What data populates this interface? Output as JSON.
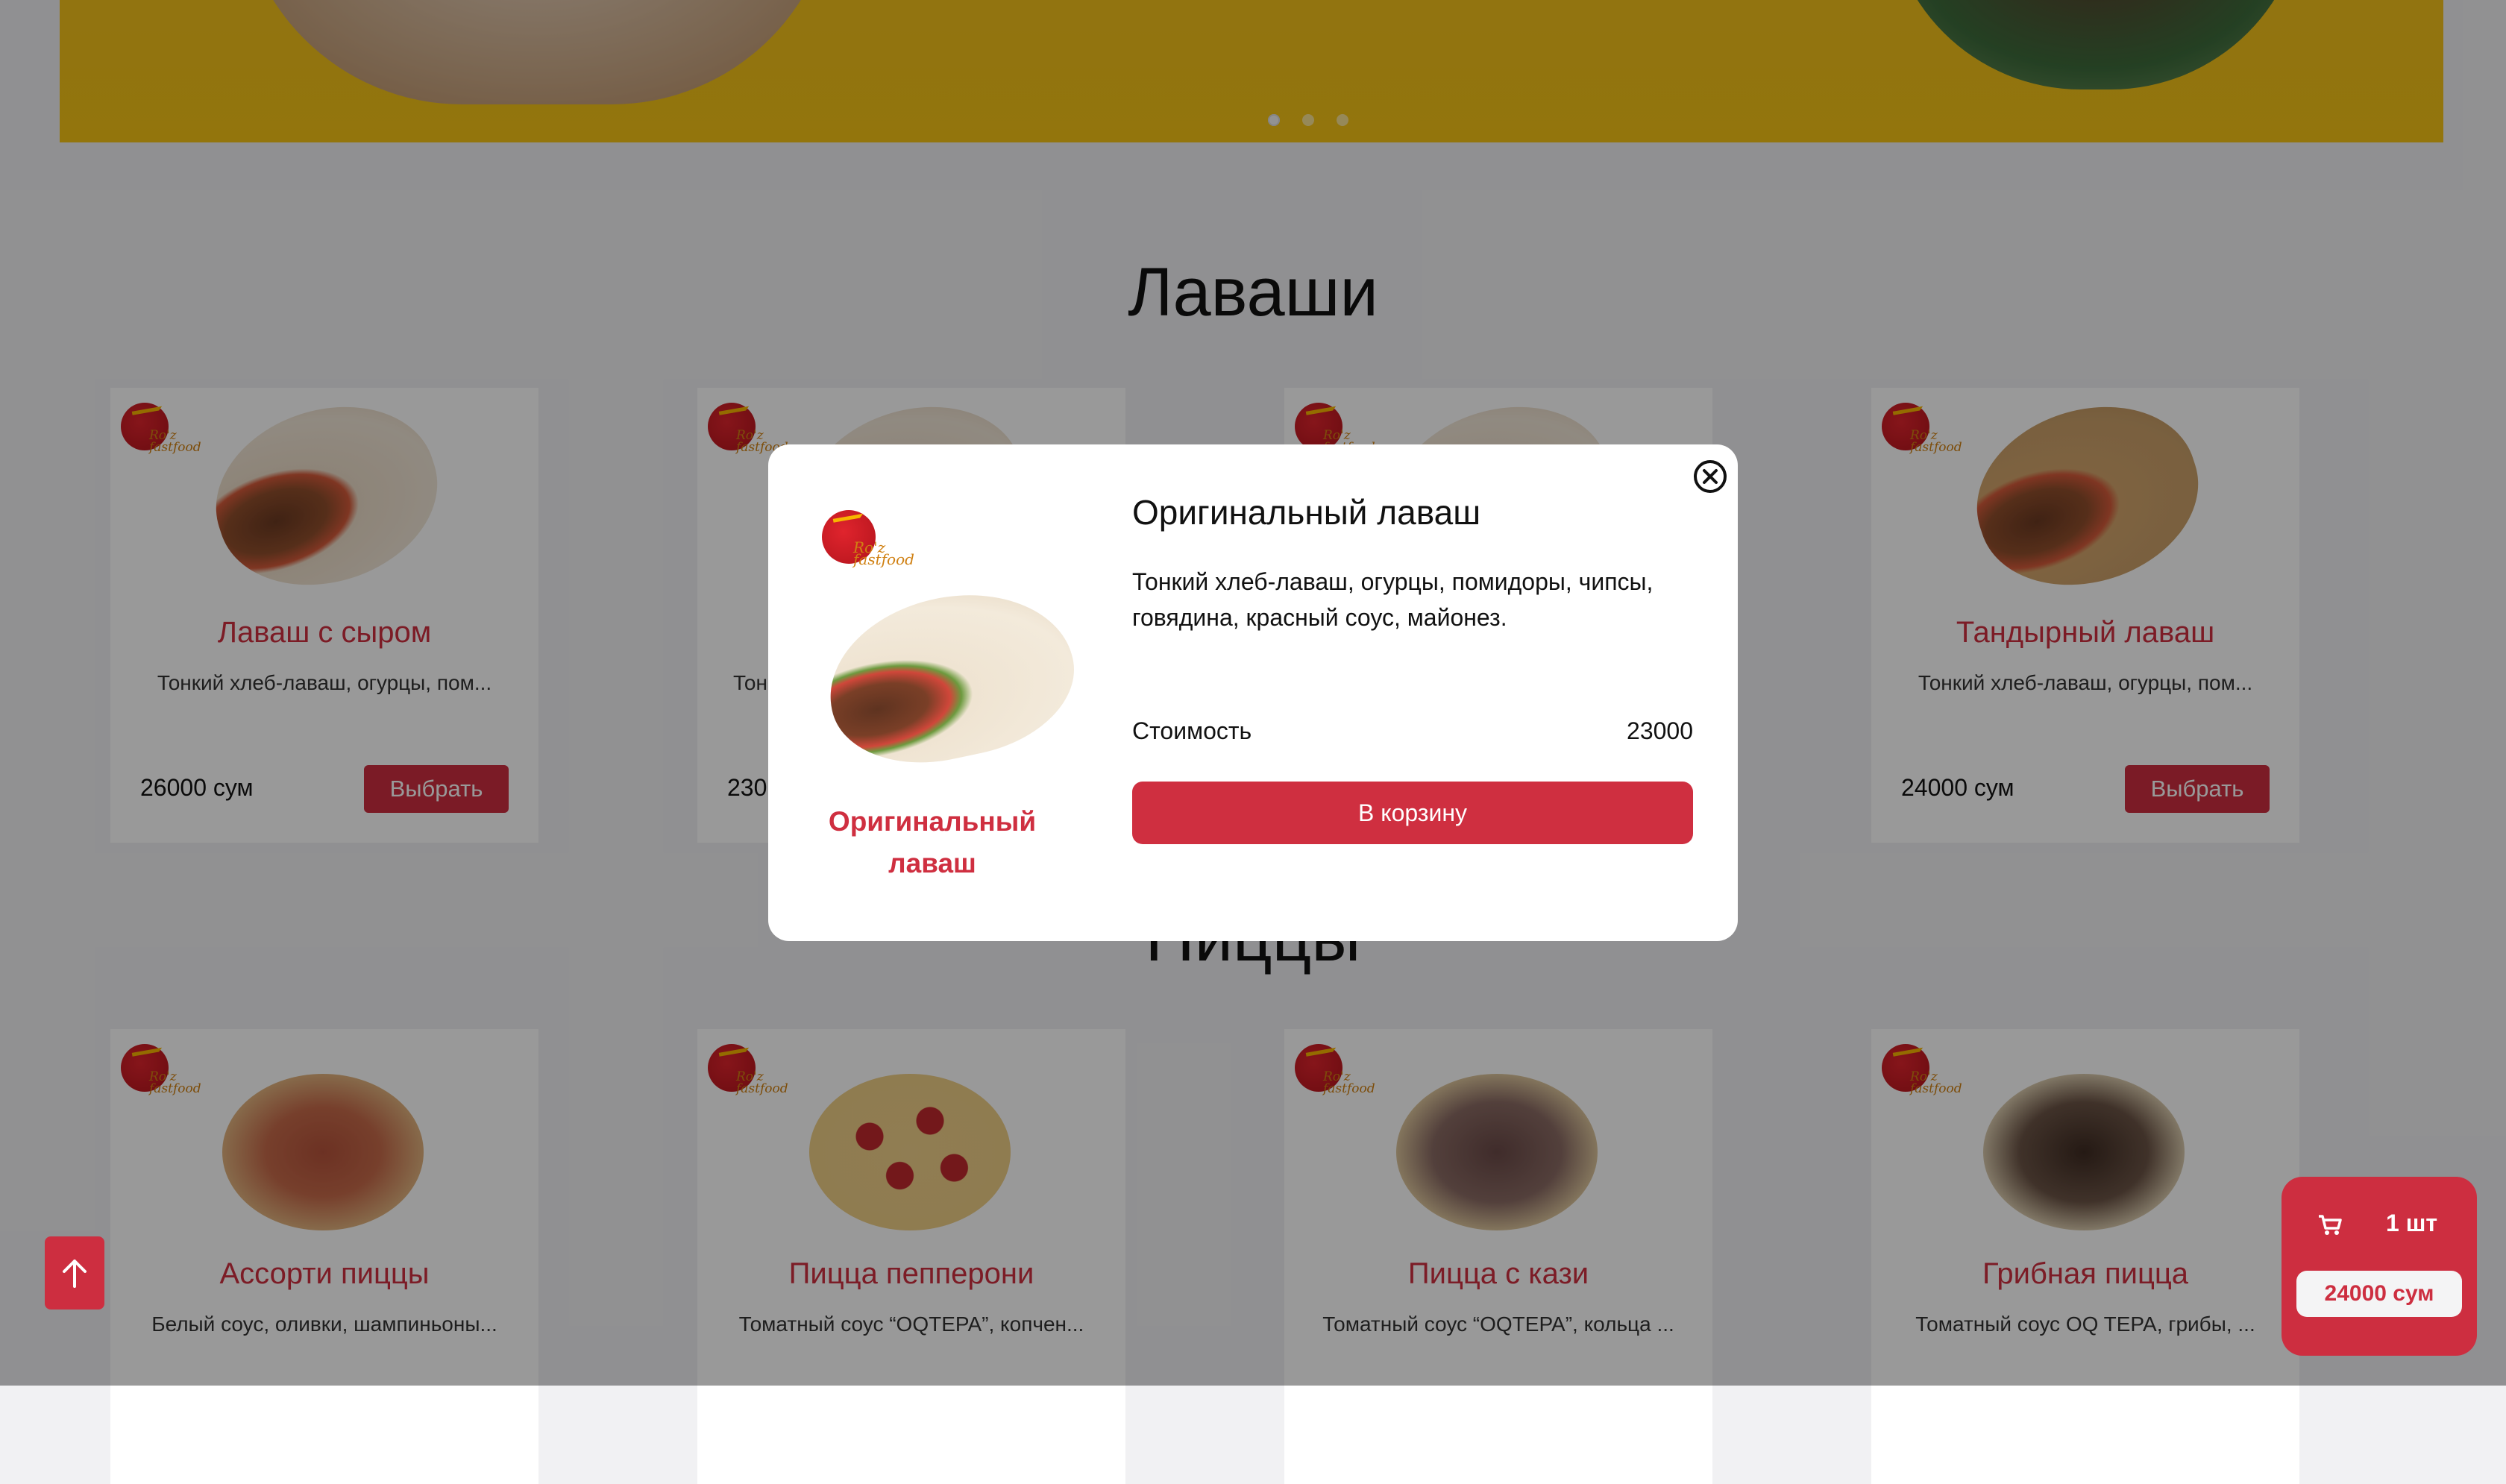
{
  "hero": {
    "active_slide": 1,
    "slide_count": 3
  },
  "sections": {
    "lavash_title": "Лаваши",
    "pizza_title": "Пиццы"
  },
  "logo_text": "Ro'z fastfood",
  "lavash_cards": [
    {
      "name": "Лаваш с сыром",
      "desc": "Тонкий хлеб-лаваш, огурцы, пом...",
      "price": "26000 сум",
      "button": "Выбрать"
    },
    {
      "name": "",
      "desc": "Тон",
      "price": "230",
      "button": ""
    },
    {
      "name": "",
      "desc": "",
      "price": "",
      "button": ""
    },
    {
      "name": "Тандырный лаваш",
      "desc": "Тонкий хлеб-лаваш, огурцы, пом...",
      "price": "24000 сум",
      "button": "Выбрать"
    }
  ],
  "pizza_cards": [
    {
      "name": "Ассорти пиццы",
      "desc": "Белый соус, оливки, шампиньоны..."
    },
    {
      "name": "Пицца пепперони",
      "desc": "Томатный соус “OQTEPA”, копчен..."
    },
    {
      "name": "Пицца с кази",
      "desc": "Томатный соус “OQTEPA”, кольца ..."
    },
    {
      "name": "Грибная пицца",
      "desc": "Томатный соус OQ TEPA, грибы, ..."
    }
  ],
  "modal": {
    "title": "Оригинальный лаваш",
    "description": "Тонкий хлеб-лаваш, огурцы, помидоры, чипсы, говядина, красный соус, майонез.",
    "image_caption": "Оригинальный лаваш",
    "cost_label": "Стоимость",
    "cost_value": "23000",
    "add_button": "В корзину"
  },
  "cart": {
    "count": "1 шт",
    "total": "24000 сум"
  },
  "colors": {
    "accent": "#cd2e40",
    "hero_bg": "#f3c21c",
    "page_bg": "#f1f1f3"
  },
  "icons": {
    "close": "close-circle-icon",
    "cart": "cart-icon",
    "scroll_top": "arrow-up-icon"
  }
}
